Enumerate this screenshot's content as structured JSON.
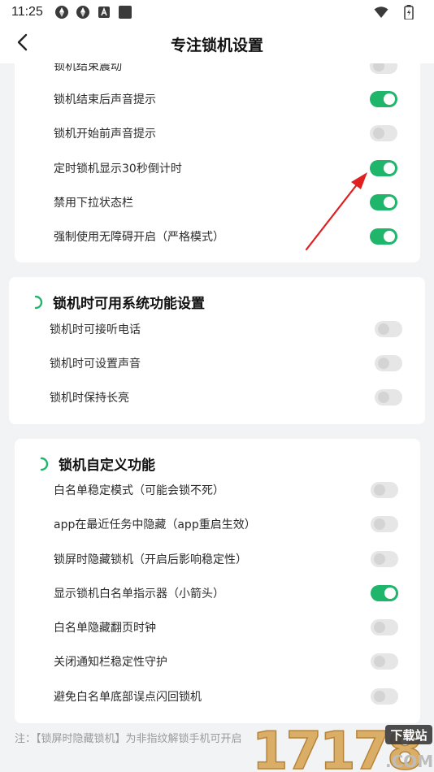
{
  "status_bar": {
    "time": "11:25",
    "icons_left": [
      "aperture-icon",
      "aperture-icon",
      "app-a-icon",
      "square-icon"
    ],
    "icons_right": [
      "wifi-icon",
      "battery-charging-icon"
    ]
  },
  "header": {
    "title": "专注锁机设置",
    "back_icon": "chevron-left-icon"
  },
  "card1": {
    "rows": [
      {
        "label": "锁机结束震动",
        "on": false
      },
      {
        "label": "锁机结束后声音提示",
        "on": true
      },
      {
        "label": "锁机开始前声音提示",
        "on": false
      },
      {
        "label": "定时锁机显示30秒倒计时",
        "on": true
      },
      {
        "label": "禁用下拉状态栏",
        "on": true
      },
      {
        "label": "强制使用无障碍开启（严格模式）",
        "on": true
      }
    ]
  },
  "card2": {
    "title": "锁机时可用系统功能设置",
    "rows": [
      {
        "label": "锁机时可接听电话",
        "on": false
      },
      {
        "label": "锁机时可设置声音",
        "on": false
      },
      {
        "label": "锁机时保持长亮",
        "on": false
      }
    ]
  },
  "card3": {
    "title": "锁机自定义功能",
    "rows": [
      {
        "label": "白名单稳定模式（可能会锁不死）",
        "on": false
      },
      {
        "label": "app在最近任务中隐藏（app重启生效）",
        "on": false
      },
      {
        "label": "锁屏时隐藏锁机（开启后影响稳定性）",
        "on": false
      },
      {
        "label": "显示锁机白名单指示器（小箭头）",
        "on": true
      },
      {
        "label": "白名单隐藏翻页时钟",
        "on": false
      },
      {
        "label": "关闭通知栏稳定性守护",
        "on": false
      },
      {
        "label": "避免白名单底部误点闪回锁机",
        "on": false
      }
    ]
  },
  "footnote": "注：【锁屏时隐藏锁机】为非指纹解锁手机可开启",
  "watermark": {
    "number": "17178",
    "tag": "下载站",
    "domain": ".COM"
  },
  "colors": {
    "accent": "#1fb56b",
    "annotation_arrow": "#e02020"
  }
}
